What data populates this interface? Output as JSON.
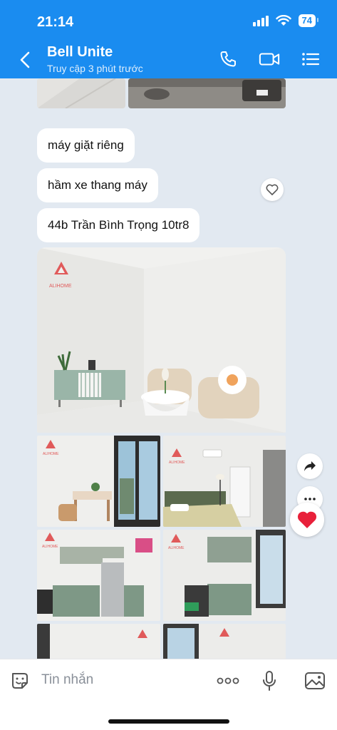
{
  "status_bar": {
    "time": "21:14",
    "battery": "74"
  },
  "header": {
    "title": "Bell Unite",
    "subtitle": "Truy cập 3 phút trước"
  },
  "messages": [
    {
      "text": "máy giặt riêng"
    },
    {
      "text": "hầm xe thang máy"
    },
    {
      "text": "44b Trần Bình Trọng 10tr8"
    }
  ],
  "photo_watermark": "ALIHOME",
  "input": {
    "placeholder": "Tin nhắn"
  },
  "colors": {
    "accent": "#1a8cf0",
    "background": "#e2e9f1",
    "reaction": "#e8203a"
  }
}
